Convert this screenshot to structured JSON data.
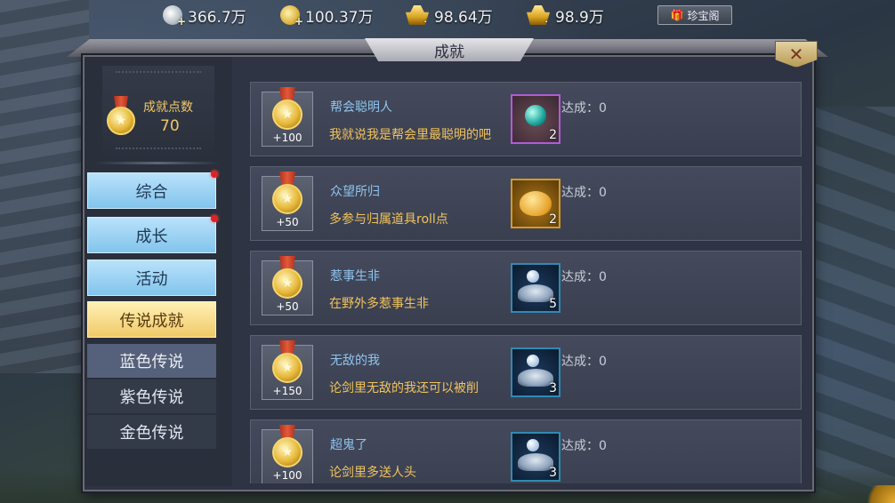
{
  "currencies": [
    {
      "icon": "silver-coin-icon",
      "value": "366.7万"
    },
    {
      "icon": "copper-coin-icon",
      "value": "100.37万"
    },
    {
      "icon": "gold-ingot-icon",
      "value": "98.64万"
    },
    {
      "icon": "gold-ingot-icon",
      "value": "98.9万"
    }
  ],
  "shop": {
    "label": "珍宝阁",
    "icon": "gift-icon"
  },
  "window": {
    "title": "成就",
    "close_icon": "close-icon"
  },
  "points": {
    "label": "成就点数",
    "value": "70"
  },
  "categories": [
    {
      "label": "综合",
      "has_alert": true
    },
    {
      "label": "成长",
      "has_alert": true
    },
    {
      "label": "活动",
      "has_alert": false
    },
    {
      "label": "传说成就",
      "has_alert": false,
      "active": true
    }
  ],
  "subcategories": [
    {
      "label": "蓝色传说",
      "selected": true
    },
    {
      "label": "紫色传说",
      "selected": false
    },
    {
      "label": "金色传说",
      "selected": false
    }
  ],
  "achievements": [
    {
      "title": "帮会聪明人",
      "desc": "我就说我是帮会里最聪明的吧",
      "points": "+100",
      "reward": {
        "icon": "orb-icon",
        "qty": "2",
        "rarity": "purple"
      },
      "reached": "达成：0"
    },
    {
      "title": "众望所归",
      "desc": "多参与归属道具roll点",
      "points": "+50",
      "reward": {
        "icon": "gold-pig-icon",
        "qty": "2",
        "rarity": "gold"
      },
      "reached": "达成：0"
    },
    {
      "title": "惹事生非",
      "desc": "在野外多惹事生非",
      "points": "+50",
      "reward": {
        "icon": "silver-coins-icon",
        "qty": "5",
        "rarity": "blue"
      },
      "reached": "达成：0"
    },
    {
      "title": "无敌的我",
      "desc": "论剑里无敌的我还可以被削",
      "points": "+150",
      "reward": {
        "icon": "silver-coins-icon",
        "qty": "3",
        "rarity": "blue"
      },
      "reached": "达成：0"
    },
    {
      "title": "超鬼了",
      "desc": "论剑里多送人头",
      "points": "+100",
      "reward": {
        "icon": "silver-coins-icon",
        "qty": "3",
        "rarity": "blue"
      },
      "reached": "达成：0"
    }
  ],
  "colors": {
    "category_bg": "#82c4ec",
    "category_active_bg": "#f0c968",
    "title_text": "#8fc4ef",
    "desc_text": "#f1c35c",
    "alert_dot": "#e02222"
  }
}
